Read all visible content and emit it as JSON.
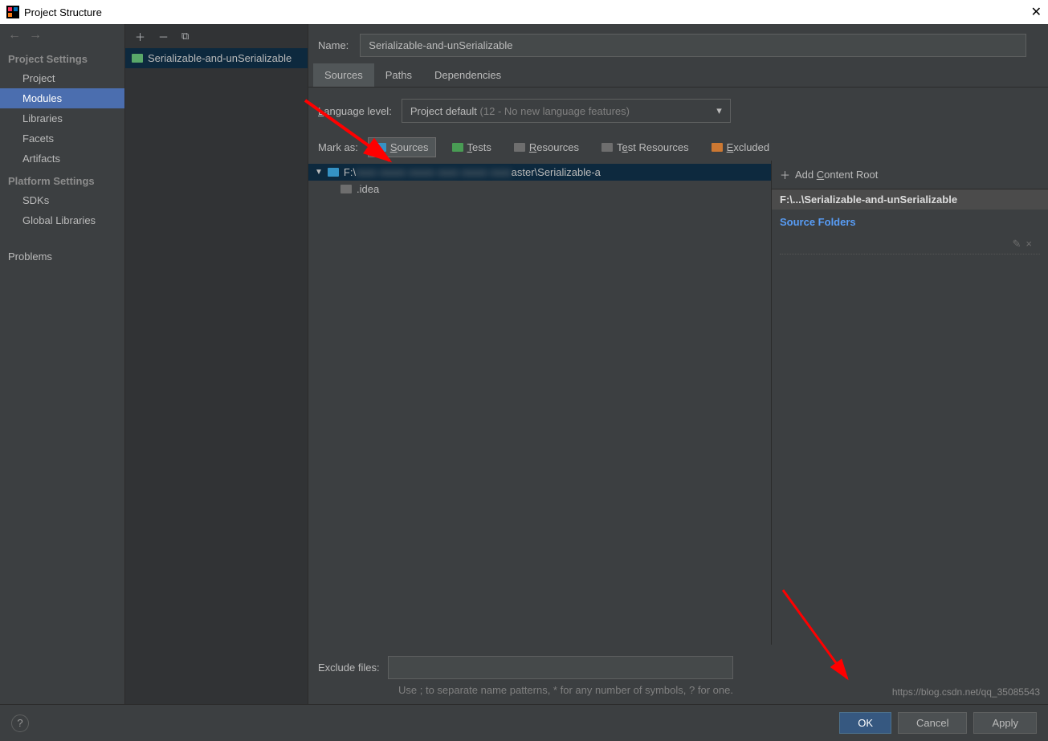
{
  "window": {
    "title": "Project Structure"
  },
  "sidebar": {
    "sections": [
      {
        "title": "Project Settings",
        "items": [
          "Project",
          "Modules",
          "Libraries",
          "Facets",
          "Artifacts"
        ],
        "selected": 1
      },
      {
        "title": "Platform Settings",
        "items": [
          "SDKs",
          "Global Libraries"
        ]
      }
    ],
    "problems": "Problems"
  },
  "moduleList": {
    "item": "Serializable-and-unSerializable"
  },
  "main": {
    "nameLabel": "Name:",
    "nameValue": "Serializable-and-unSerializable",
    "tabs": [
      "Sources",
      "Paths",
      "Dependencies"
    ],
    "activeTab": 0,
    "langLabel": "Language level:",
    "langValue": "Project default",
    "langDim": "(12 - No new language features)",
    "markLabel": "Mark as:",
    "markButtons": [
      {
        "label": "Sources",
        "color": "#3592c4",
        "active": true
      },
      {
        "label": "Tests",
        "color": "#499c54",
        "active": false
      },
      {
        "label": "Resources",
        "color": "#6e6e6e",
        "active": false
      },
      {
        "label": "Test Resources",
        "color": "#6e6e6e",
        "active": false
      },
      {
        "label": "Excluded",
        "color": "#cc7832",
        "active": false
      }
    ],
    "tree": {
      "root": "F:\\...aster\\Serializable-a",
      "child": ".idea"
    },
    "rightPanel": {
      "addRoot": "Add Content Root",
      "rootPath": "F:\\...\\Serializable-and-unSerializable",
      "sourceFolders": "Source Folders"
    },
    "exclude": {
      "label": "Exclude files:",
      "hint": "Use ; to separate name patterns, * for any number of symbols, ? for one."
    }
  },
  "buttons": {
    "ok": "OK",
    "cancel": "Cancel",
    "apply": "Apply"
  },
  "watermark": "https://blog.csdn.net/qq_35085543"
}
